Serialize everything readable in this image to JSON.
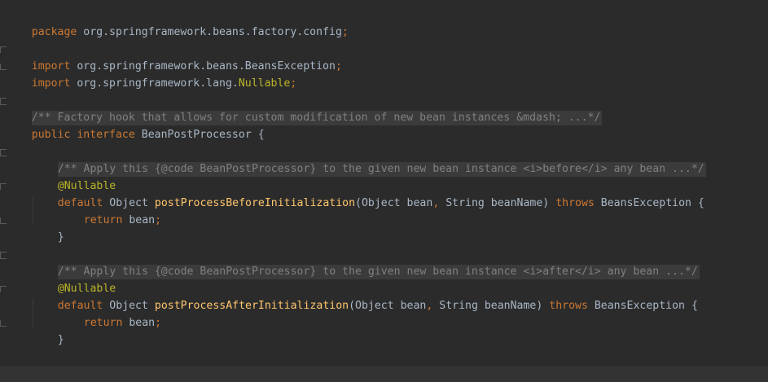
{
  "code": {
    "package_kw": "package",
    "package_name": "org.springframework.beans.factory.config",
    "semicolon": ";",
    "import_kw": "import",
    "import1_path": "org.springframework.beans.BeansException",
    "import2_path": "org.springframework.lang.",
    "import2_name": "Nullable",
    "class_doc": "/** Factory hook that allows for custom modification of new bean instances &mdash; ...*/",
    "public_kw": "public",
    "interface_kw": "interface",
    "interface_name": "BeanPostProcessor",
    "open_brace": "{",
    "close_brace": "}",
    "method1_doc": "/** Apply this {@code BeanPostProcessor} to the given new bean instance <i>before</i> any bean ...*/",
    "method2_doc": "/** Apply this {@code BeanPostProcessor} to the given new bean instance <i>after</i> any bean ...*/",
    "annotation": "@Nullable",
    "default_kw": "default",
    "object_type": "Object",
    "method1_name": "postProcessBeforeInitialization",
    "method2_name": "postProcessAfterInitialization",
    "params_open": "(Object bean",
    "comma": ",",
    "params_rest": " String beanName)",
    "throws_kw": "throws",
    "exception_name": "BeansException",
    "return_kw": "return",
    "return_value": "bean"
  },
  "colors": {
    "background": "#2b2b2b",
    "keyword": "#cc7832",
    "text": "#a9b7c6",
    "annotation": "#bbb529",
    "method": "#ffc66d",
    "doc_comment": "#808080",
    "doc_background": "#3b3b3b"
  }
}
